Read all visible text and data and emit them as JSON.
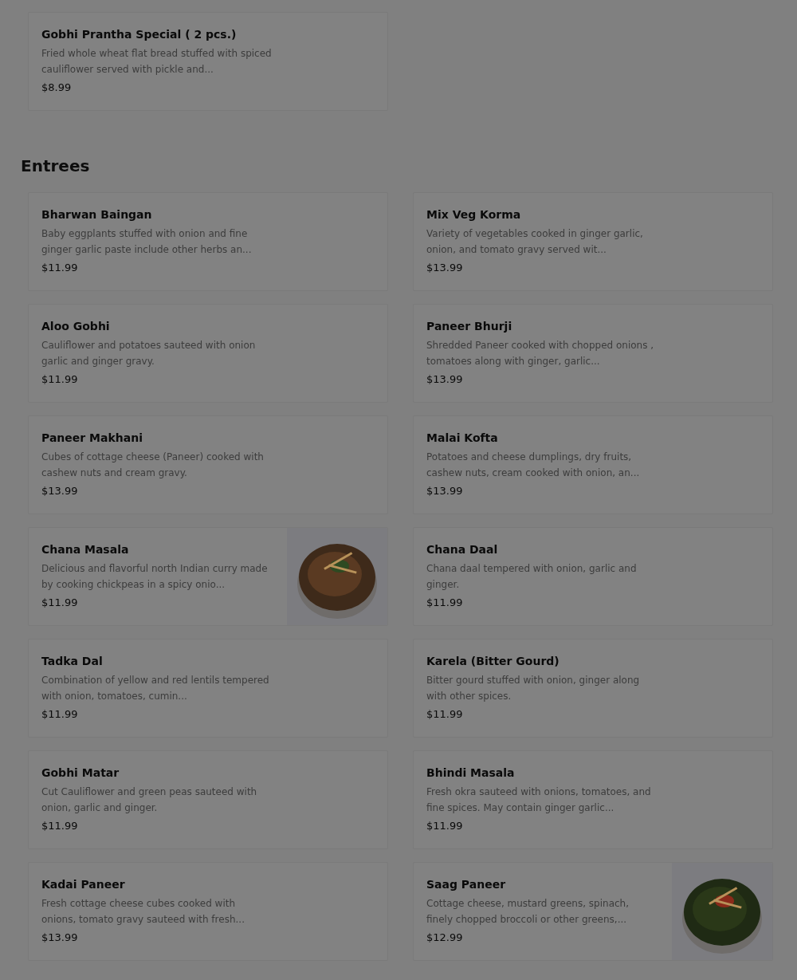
{
  "sections": [
    {
      "items": [
        {
          "name": "Gobhi Prantha Special ( 2 pcs.)",
          "description": "Fried whole wheat flat bread stuffed with spiced cauliflower served with pickle and...",
          "price": "$8.99"
        }
      ]
    },
    {
      "title": "Entrees",
      "items": [
        {
          "name": "Bharwan Baingan",
          "description": "Baby eggplants stuffed with onion and fine ginger garlic paste include other herbs an...",
          "price": "$11.99"
        },
        {
          "name": "Mix Veg Korma",
          "description": "Variety of vegetables cooked in ginger garlic, onion, and tomato gravy served wit...",
          "price": "$13.99"
        },
        {
          "name": "Aloo Gobhi",
          "description": "Cauliflower and potatoes sauteed with onion garlic and ginger gravy.",
          "price": "$11.99"
        },
        {
          "name": "Paneer Bhurji",
          "description": "Shredded Paneer cooked with chopped onions , tomatoes along with ginger, garlic...",
          "price": "$13.99"
        },
        {
          "name": "Paneer Makhani",
          "description": "Cubes of cottage cheese (Paneer) cooked with cashew nuts and cream gravy.",
          "price": "$13.99"
        },
        {
          "name": "Malai Kofta",
          "description": "Potatoes and cheese dumplings, dry fruits, cashew nuts, cream cooked with onion, an...",
          "price": "$13.99"
        },
        {
          "name": "Chana Masala",
          "description": "Delicious and flavorful north Indian curry made by cooking chickpeas in a spicy onio...",
          "price": "$11.99"
        },
        {
          "name": "Chana Daal",
          "description": "Chana daal tempered with onion, garlic and ginger.",
          "price": "$11.99"
        },
        {
          "name": "Tadka Dal",
          "description": "Combination of yellow and red lentils tempered with onion, tomatoes, cumin...",
          "price": "$11.99"
        },
        {
          "name": "Karela (Bitter Gourd)",
          "description": "Bitter gourd stuffed with onion, ginger along with other spices.",
          "price": "$11.99"
        },
        {
          "name": "Gobhi Matar",
          "description": "Cut Cauliflower and green peas sauteed with onion, garlic and ginger.",
          "price": "$11.99"
        },
        {
          "name": "Bhindi Masala",
          "description": "Fresh okra sauteed with onions, tomatoes, and fine spices. May contain ginger garlic...",
          "price": "$11.99"
        },
        {
          "name": "Kadai Paneer",
          "description": "Fresh cottage cheese cubes cooked with onions, tomato gravy sauteed with fresh...",
          "price": "$13.99"
        },
        {
          "name": "Saag Paneer",
          "description": "Cottage cheese, mustard greens, spinach, finely chopped broccoli or other greens,...",
          "price": "$12.99"
        }
      ]
    }
  ]
}
